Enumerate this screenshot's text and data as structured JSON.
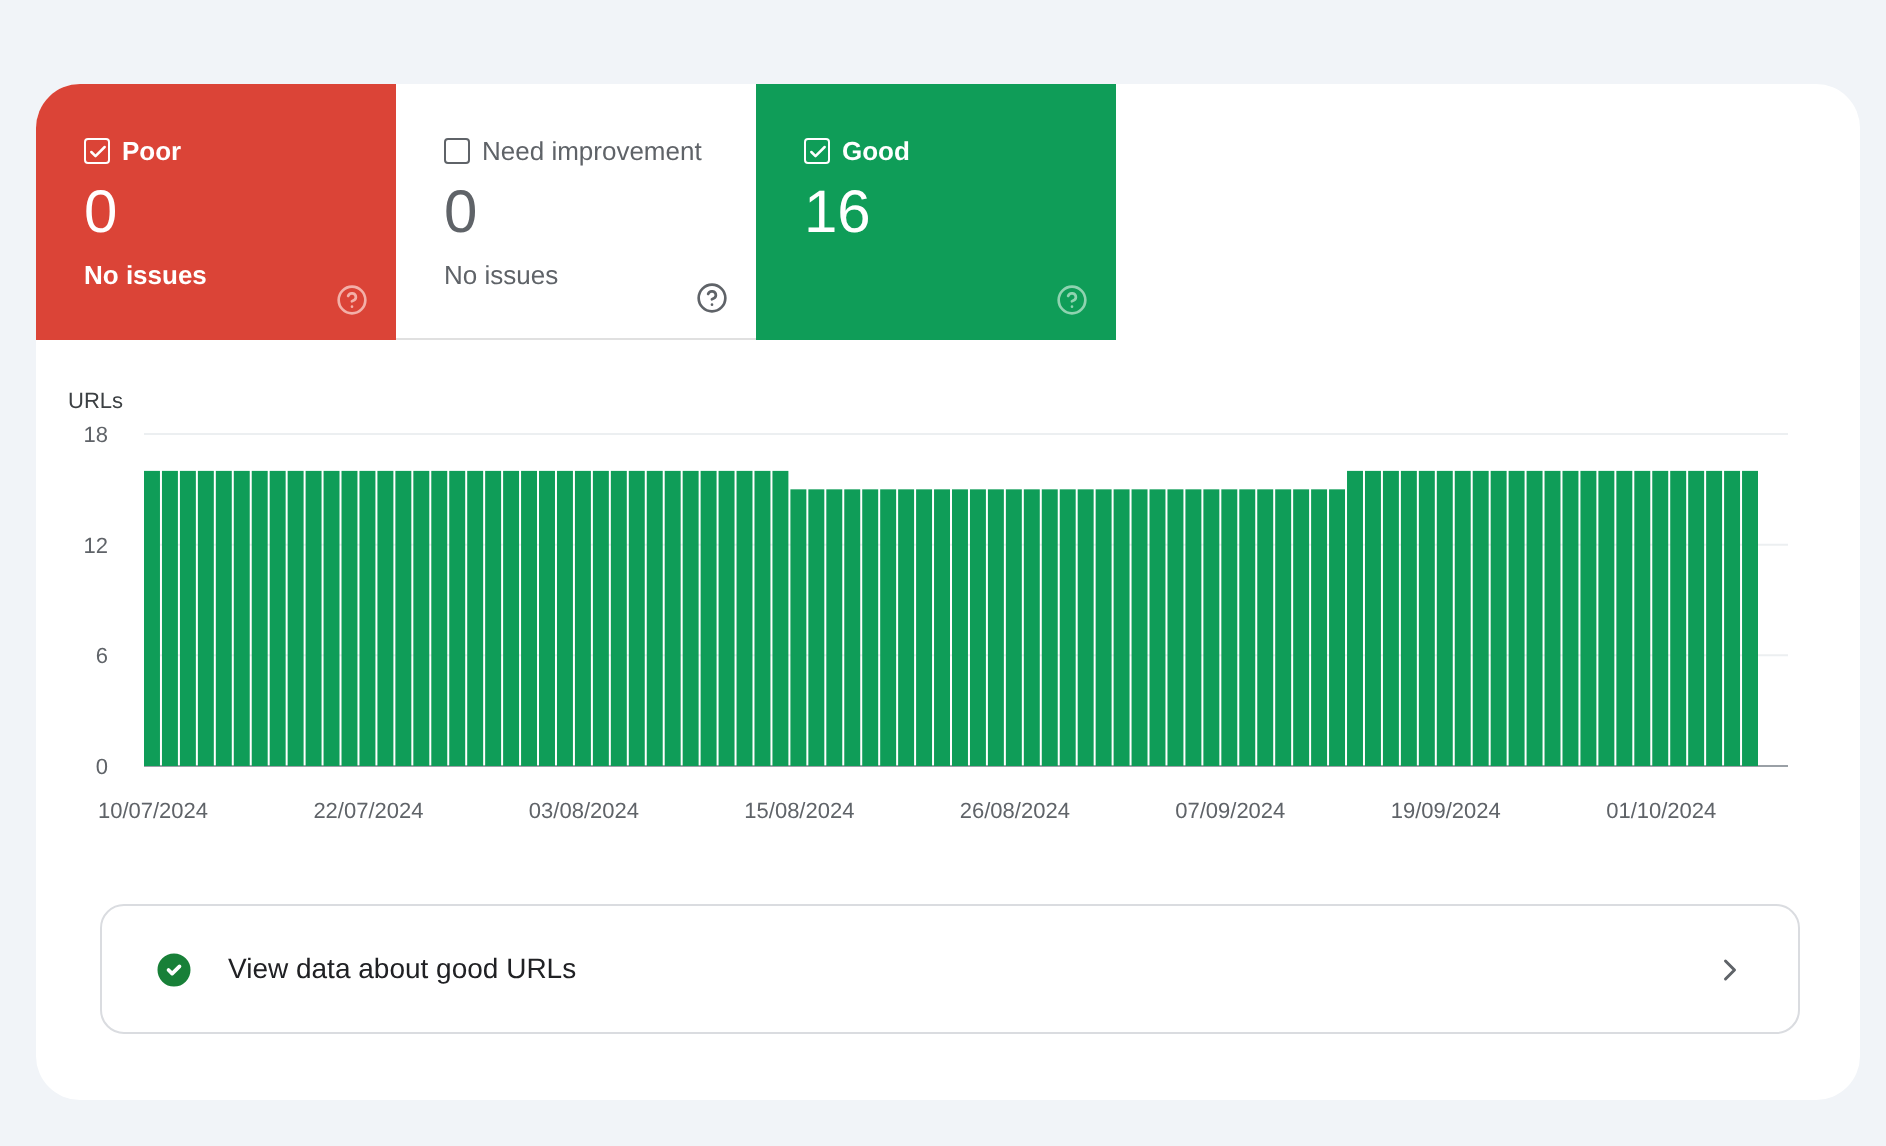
{
  "status_tiles": [
    {
      "kind": "poor",
      "label": "Poor",
      "checked": true,
      "count": "0",
      "note": "No issues"
    },
    {
      "kind": "need",
      "label": "Need improvement",
      "checked": false,
      "count": "0",
      "note": "No issues"
    },
    {
      "kind": "good",
      "label": "Good",
      "checked": true,
      "count": "16"
    }
  ],
  "chart": {
    "chart_data": {
      "type": "bar",
      "ylabel": "URLs",
      "ylim": [
        0,
        18
      ],
      "yticks": [
        0,
        6,
        12,
        18
      ],
      "categories": [
        "10/07/2024",
        null,
        null,
        null,
        null,
        null,
        null,
        null,
        null,
        null,
        null,
        null,
        "22/07/2024",
        null,
        null,
        null,
        null,
        null,
        null,
        null,
        null,
        null,
        null,
        null,
        "03/08/2024",
        null,
        null,
        null,
        null,
        null,
        null,
        null,
        null,
        null,
        null,
        null,
        "15/08/2024",
        null,
        null,
        null,
        null,
        null,
        null,
        null,
        null,
        null,
        null,
        null,
        "26/08/2024",
        null,
        null,
        null,
        null,
        null,
        null,
        null,
        null,
        null,
        null,
        null,
        "07/09/2024",
        null,
        null,
        null,
        null,
        null,
        null,
        null,
        null,
        null,
        null,
        null,
        "19/09/2024",
        null,
        null,
        null,
        null,
        null,
        null,
        null,
        null,
        null,
        null,
        null,
        "01/10/2024",
        null,
        null,
        null,
        null,
        null
      ],
      "series": [
        {
          "color": "#0f9d58",
          "values": [
            16,
            16,
            16,
            16,
            16,
            16,
            16,
            16,
            16,
            16,
            16,
            16,
            16,
            16,
            16,
            16,
            16,
            16,
            16,
            16,
            16,
            16,
            16,
            16,
            16,
            16,
            16,
            16,
            16,
            16,
            16,
            16,
            16,
            16,
            16,
            16,
            15,
            15,
            15,
            15,
            15,
            15,
            15,
            15,
            15,
            15,
            15,
            15,
            15,
            15,
            15,
            15,
            15,
            15,
            15,
            15,
            15,
            15,
            15,
            15,
            15,
            15,
            15,
            15,
            15,
            15,
            15,
            16,
            16,
            16,
            16,
            16,
            16,
            16,
            16,
            16,
            16,
            16,
            16,
            16,
            16,
            16,
            16,
            16,
            16,
            16,
            16,
            16,
            16,
            16
          ]
        }
      ]
    }
  },
  "details_link": {
    "label": "View data about good URLs"
  }
}
